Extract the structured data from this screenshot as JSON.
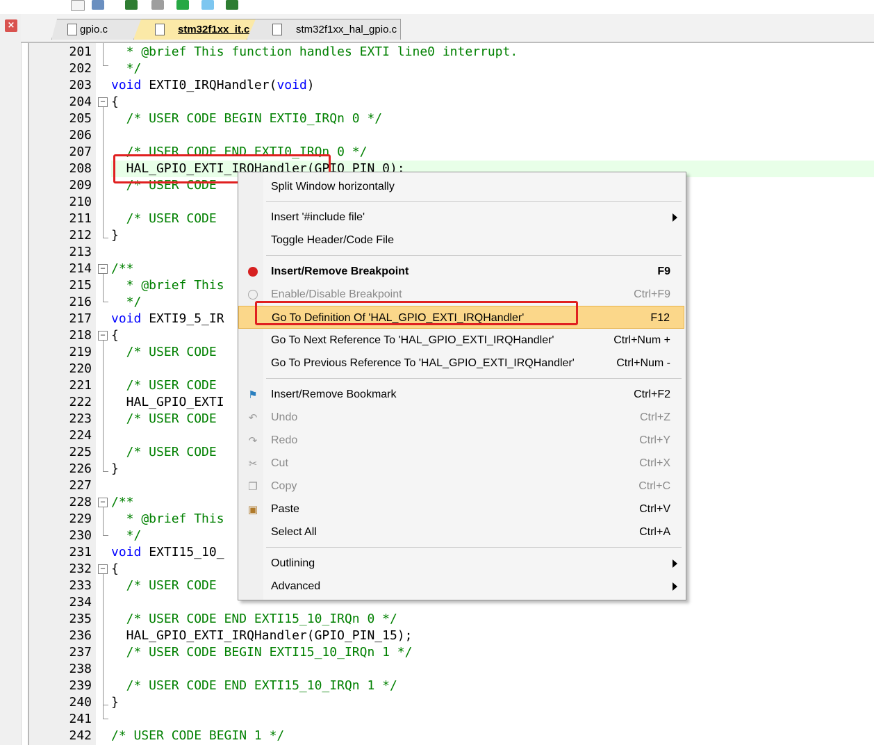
{
  "tabs": [
    {
      "label": "gpio.c"
    },
    {
      "label": "stm32f1xx_it.c"
    },
    {
      "label": "stm32f1xx_hal_gpio.c"
    }
  ],
  "close_glyph": "×",
  "lines": [
    {
      "num": "201",
      "text": "  * @brief This function handles EXTI line0 interrupt."
    },
    {
      "num": "202",
      "text": "  */"
    },
    {
      "num": "203",
      "text": "void EXTI0_IRQHandler(void)"
    },
    {
      "num": "204",
      "text": "{"
    },
    {
      "num": "205",
      "text": "  /* USER CODE BEGIN EXTI0_IRQn 0 */"
    },
    {
      "num": "206",
      "text": ""
    },
    {
      "num": "207",
      "text": "  /* USER CODE END EXTI0_IRQn 0 */"
    },
    {
      "num": "208",
      "text": "  HAL_GPIO_EXTI_IRQHandler(GPIO_PIN_0);"
    },
    {
      "num": "209",
      "text": "  /* USER CODE"
    },
    {
      "num": "210",
      "text": ""
    },
    {
      "num": "211",
      "text": "  /* USER CODE"
    },
    {
      "num": "212",
      "text": "}"
    },
    {
      "num": "213",
      "text": ""
    },
    {
      "num": "214",
      "text": "/**"
    },
    {
      "num": "215",
      "text": "  * @brief This"
    },
    {
      "num": "216",
      "text": "  */"
    },
    {
      "num": "217",
      "text": "void EXTI9_5_IR"
    },
    {
      "num": "218",
      "text": "{"
    },
    {
      "num": "219",
      "text": "  /* USER CODE"
    },
    {
      "num": "220",
      "text": ""
    },
    {
      "num": "221",
      "text": "  /* USER CODE"
    },
    {
      "num": "222",
      "text": "  HAL_GPIO_EXTI"
    },
    {
      "num": "223",
      "text": "  /* USER CODE"
    },
    {
      "num": "224",
      "text": ""
    },
    {
      "num": "225",
      "text": "  /* USER CODE"
    },
    {
      "num": "226",
      "text": "}"
    },
    {
      "num": "227",
      "text": ""
    },
    {
      "num": "228",
      "text": "/**"
    },
    {
      "num": "229",
      "text": "  * @brief This"
    },
    {
      "num": "230",
      "text": "  */"
    },
    {
      "num": "231",
      "text": "void EXTI15_10_"
    },
    {
      "num": "232",
      "text": "{"
    },
    {
      "num": "233",
      "text": "  /* USER CODE"
    },
    {
      "num": "234",
      "text": ""
    },
    {
      "num": "235",
      "text": "  /* USER CODE END EXTI15_10_IRQn 0 */"
    },
    {
      "num": "236",
      "text": "  HAL_GPIO_EXTI_IRQHandler(GPIO_PIN_15);"
    },
    {
      "num": "237",
      "text": "  /* USER CODE BEGIN EXTI15_10_IRQn 1 */"
    },
    {
      "num": "238",
      "text": ""
    },
    {
      "num": "239",
      "text": "  /* USER CODE END EXTI15_10_IRQn 1 */"
    },
    {
      "num": "240",
      "text": "}"
    },
    {
      "num": "241",
      "text": ""
    },
    {
      "num": "242",
      "text": "/* USER CODE BEGIN 1 */"
    }
  ],
  "menu": {
    "items": [
      {
        "label": "Split Window horizontally",
        "shortcut": ""
      },
      {
        "label": "Insert '#include file'",
        "shortcut": ""
      },
      {
        "label": "Toggle Header/Code File",
        "shortcut": ""
      },
      {
        "label": "Insert/Remove Breakpoint",
        "shortcut": "F9"
      },
      {
        "label": "Enable/Disable Breakpoint",
        "shortcut": "Ctrl+F9"
      },
      {
        "label": "Go To Definition Of 'HAL_GPIO_EXTI_IRQHandler'",
        "shortcut": "F12"
      },
      {
        "label": "Go To Next Reference To 'HAL_GPIO_EXTI_IRQHandler'",
        "shortcut": "Ctrl+Num +"
      },
      {
        "label": "Go To Previous Reference To 'HAL_GPIO_EXTI_IRQHandler'",
        "shortcut": "Ctrl+Num -"
      },
      {
        "label": "Insert/Remove Bookmark",
        "shortcut": "Ctrl+F2"
      },
      {
        "label": "Undo",
        "shortcut": "Ctrl+Z"
      },
      {
        "label": "Redo",
        "shortcut": "Ctrl+Y"
      },
      {
        "label": "Cut",
        "shortcut": "Ctrl+X"
      },
      {
        "label": "Copy",
        "shortcut": "Ctrl+C"
      },
      {
        "label": "Paste",
        "shortcut": "Ctrl+V"
      },
      {
        "label": "Select All",
        "shortcut": "Ctrl+A"
      },
      {
        "label": "Outlining",
        "shortcut": ""
      },
      {
        "label": "Advanced",
        "shortcut": ""
      }
    ]
  },
  "colors": {
    "comment": "#008000",
    "keyword": "#0000ff",
    "highlight_box": "#e02020",
    "menu_active_bg": "#fbd78a",
    "active_tab_bg": "#fbe9a7"
  },
  "icons": {
    "breakpoint": "breakpoint-dot-icon",
    "breakpoint_toggle": "breakpoint-circle-icon",
    "bookmark": "bookmark-flag-icon",
    "undo": "undo-icon",
    "redo": "redo-icon",
    "cut": "scissors-icon",
    "copy": "copy-icon",
    "paste": "paste-icon",
    "submenu": "submenu-arrow-icon"
  }
}
